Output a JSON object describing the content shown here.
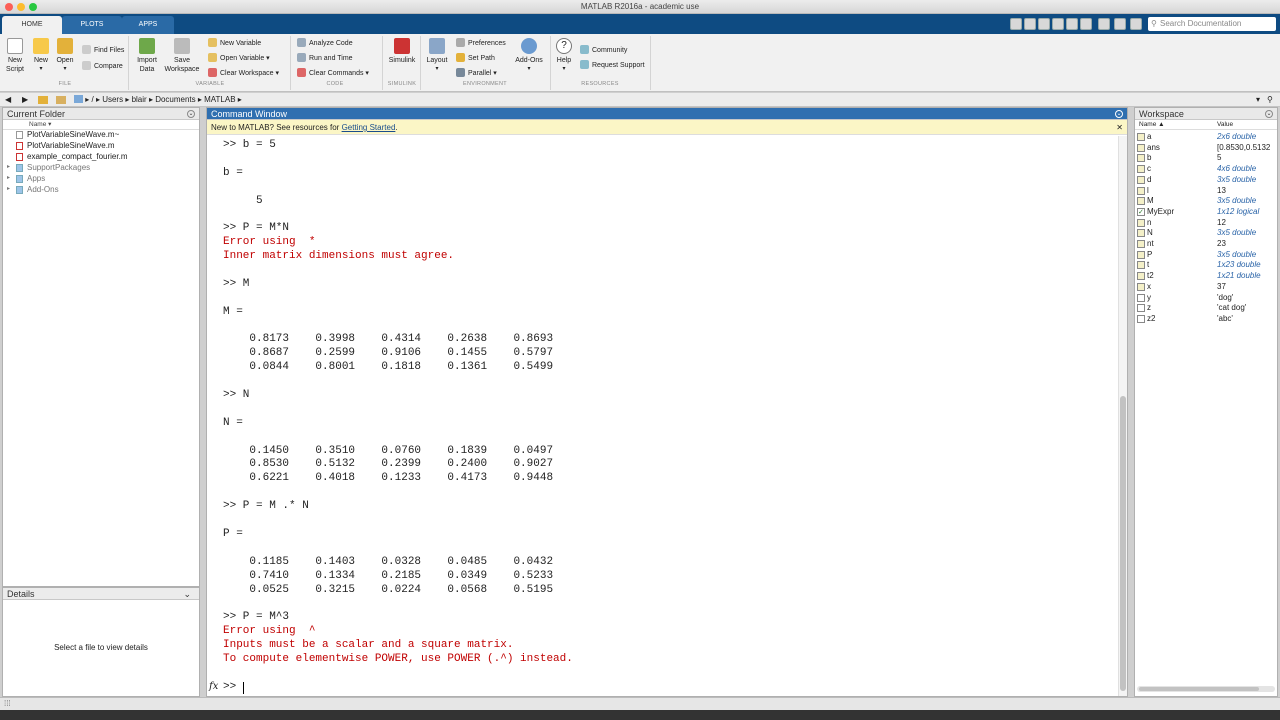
{
  "window": {
    "title": "MATLAB R2016a - academic use"
  },
  "ribbon_tabs": [
    "HOME",
    "PLOTS",
    "APPS"
  ],
  "search": {
    "placeholder": "Search Documentation"
  },
  "ribbon": {
    "file": {
      "new_script": "New\nScript",
      "new": "New",
      "open": "Open",
      "find_files": "Find Files",
      "compare": "Compare",
      "section": "FILE"
    },
    "variable": {
      "import_data": "Import\nData",
      "save_workspace": "Save\nWorkspace",
      "new_variable": "New Variable",
      "open_variable": "Open Variable",
      "clear_workspace": "Clear Workspace",
      "section": "VARIABLE"
    },
    "code": {
      "analyze_code": "Analyze Code",
      "run_and_time": "Run and Time",
      "clear_commands": "Clear Commands",
      "section": "CODE"
    },
    "simulink": {
      "simulink": "Simulink",
      "section": "SIMULINK"
    },
    "environment": {
      "layout": "Layout",
      "preferences": "Preferences",
      "set_path": "Set Path",
      "parallel": "Parallel",
      "add_ons": "Add-Ons",
      "section": "ENVIRONMENT"
    },
    "resources": {
      "help": "Help",
      "community": "Community",
      "request_support": "Request Support",
      "section": "RESOURCES"
    }
  },
  "path": [
    "/",
    "Users",
    "blair",
    "Documents",
    "MATLAB"
  ],
  "current_folder": {
    "title": "Current Folder",
    "column": "Name ▾",
    "items": [
      {
        "name": "PlotVariableSineWave.m~"
      },
      {
        "name": "PlotVariableSineWave.m"
      },
      {
        "name": "example_compact_fourier.m"
      },
      {
        "name": "SupportPackages"
      },
      {
        "name": "Apps"
      },
      {
        "name": "Add-Ons"
      }
    ]
  },
  "details": {
    "title": "Details",
    "message": "Select a file to view details"
  },
  "command_window": {
    "title": "Command Window",
    "banner_text": "New to MATLAB? See resources for ",
    "banner_link": "Getting Started",
    "banner_end": ".",
    "lines": [
      ">> b = 5",
      "",
      "b =",
      "",
      "     5",
      "",
      ">> P = M*N",
      "Error using  * ",
      "Inner matrix dimensions must agree.",
      "",
      ">> M",
      "",
      "M =",
      "",
      "    0.8173    0.3998    0.4314    0.2638    0.8693",
      "    0.8687    0.2599    0.9106    0.1455    0.5797",
      "    0.0844    0.8001    0.1818    0.1361    0.5499",
      "",
      ">> N",
      "",
      "N =",
      "",
      "    0.1450    0.3510    0.0760    0.1839    0.0497",
      "    0.8530    0.5132    0.2399    0.2400    0.9027",
      "    0.6221    0.4018    0.1233    0.4173    0.9448",
      "",
      ">> P = M .* N",
      "",
      "P =",
      "",
      "    0.1185    0.1403    0.0328    0.0485    0.0432",
      "    0.7410    0.1334    0.2185    0.0349    0.5233",
      "    0.0525    0.3215    0.0224    0.0568    0.5195",
      "",
      ">> P = M^3",
      "Error using  ^ ",
      "Inputs must be a scalar and a square matrix.",
      "To compute elementwise POWER, use POWER (.^) instead."
    ],
    "prompt": ">>",
    "fx": "fx"
  },
  "workspace": {
    "title": "Workspace",
    "col_name": "Name ▲",
    "col_value": "Value",
    "vars": [
      {
        "name": "a",
        "value": "2x6 double"
      },
      {
        "name": "ans",
        "value": "[0.8530,0.5132"
      },
      {
        "name": "b",
        "value": "5"
      },
      {
        "name": "c",
        "value": "4x6 double"
      },
      {
        "name": "d",
        "value": "3x5 double"
      },
      {
        "name": "l",
        "value": "13"
      },
      {
        "name": "M",
        "value": "3x5 double"
      },
      {
        "name": "MyExpr",
        "value": "1x12 logical"
      },
      {
        "name": "n",
        "value": "12"
      },
      {
        "name": "N",
        "value": "3x5 double"
      },
      {
        "name": "nt",
        "value": "23"
      },
      {
        "name": "P",
        "value": "3x5 double"
      },
      {
        "name": "t",
        "value": "1x23 double"
      },
      {
        "name": "t2",
        "value": "1x21 double"
      },
      {
        "name": "x",
        "value": "37"
      },
      {
        "name": "y",
        "value": "'dog'"
      },
      {
        "name": "z",
        "value": "'cat dog'"
      },
      {
        "name": "z2",
        "value": "'abc'"
      }
    ]
  }
}
